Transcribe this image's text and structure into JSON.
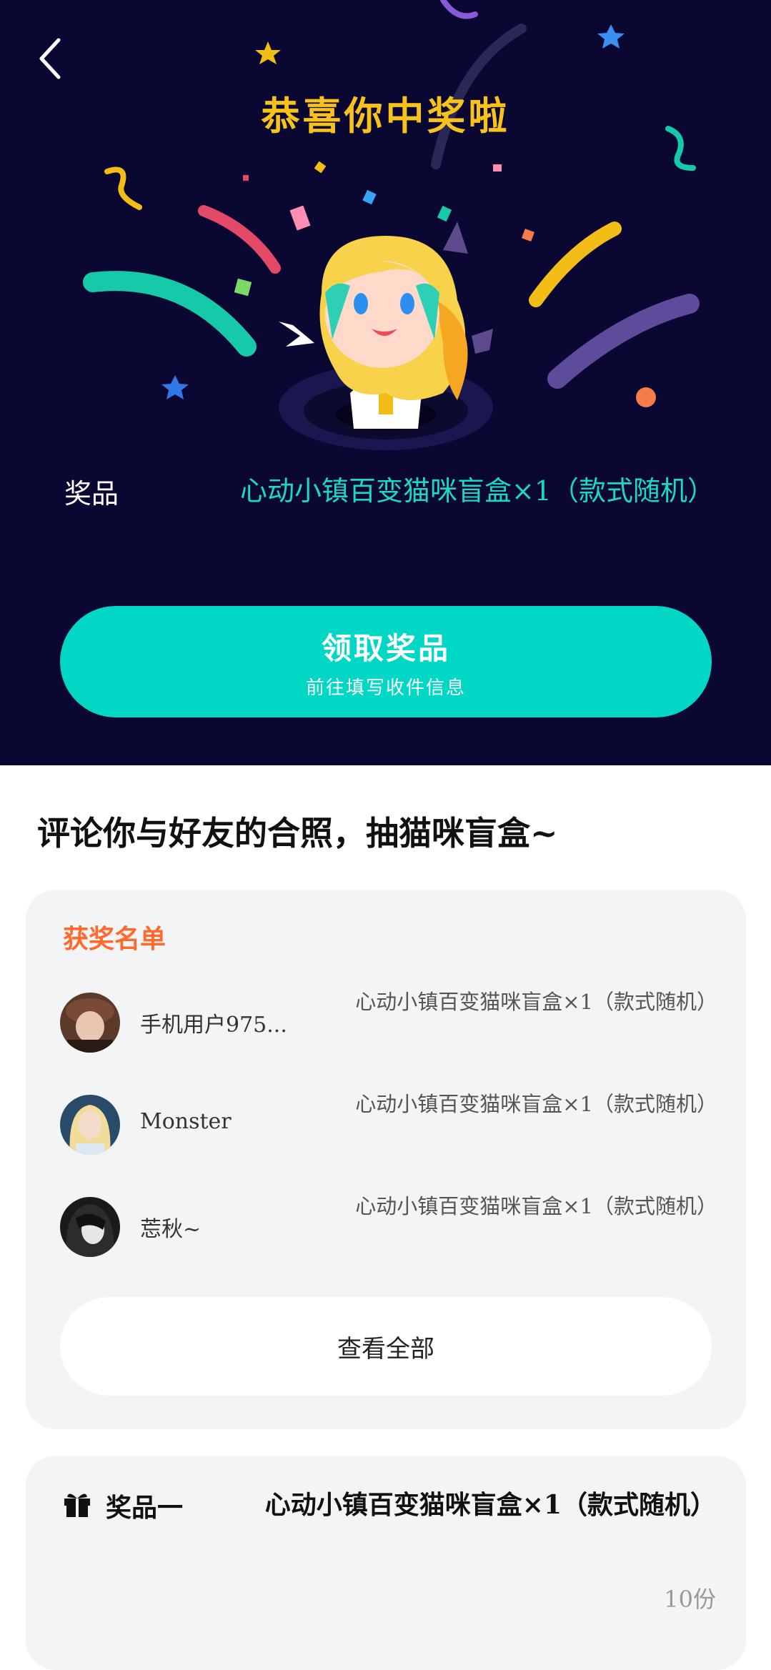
{
  "header": {
    "back_icon": "chevron-left-icon",
    "title": "恭喜你中奖啦"
  },
  "prize": {
    "label": "奖品",
    "value": "心动小镇百变猫咪盲盒×1（款式随机）"
  },
  "claim_button": {
    "title": "领取奖品",
    "subtitle": "前往填写收件信息"
  },
  "promo_text": "评论你与好友的合照，抽猫咪盲盒~",
  "winners": {
    "title": "获奖名单",
    "items": [
      {
        "name": "手机用户975...",
        "prize": "心动小镇百变猫咪盲盒×1（款式随机）"
      },
      {
        "name": "Monster",
        "prize": "心动小镇百变猫咪盲盒×1（款式随机）"
      },
      {
        "name": "莣秋~",
        "prize": "心动小镇百变猫咪盲盒×1（款式随机）"
      }
    ],
    "view_all": "查看全部"
  },
  "prize_card": {
    "icon": "gift-icon",
    "label": "奖品一",
    "value": "心动小镇百变猫咪盲盒×1（款式随机）",
    "quantity": "10份"
  },
  "colors": {
    "hero_bg": "#0a0733",
    "accent_teal": "#00d7c4",
    "title_gold": "#f7c21a",
    "winners_orange": "#ff6a2c",
    "card_bg": "#f3f4f6"
  }
}
